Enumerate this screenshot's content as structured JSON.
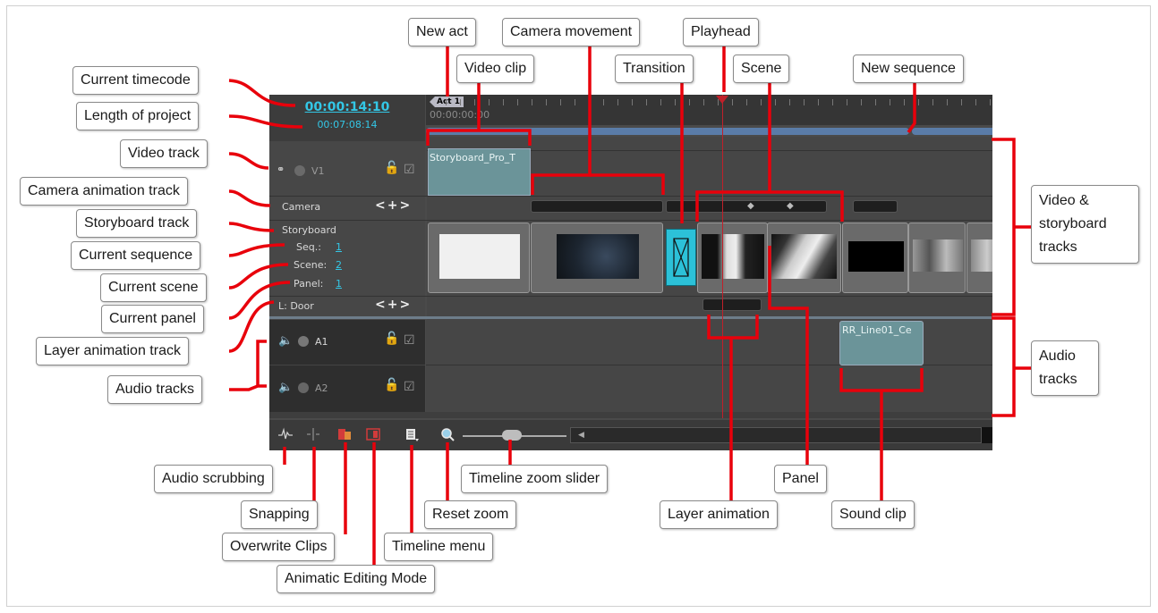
{
  "timeline": {
    "current_timecode": "00:00:14:10",
    "project_length": "00:07:08:14",
    "ruler_timecode": "00:00:00:00",
    "act_marker": "Act 1",
    "tracks": {
      "video": {
        "name": "V1"
      },
      "camera": {
        "name": "Camera"
      },
      "storyboard": {
        "name": "Storyboard"
      },
      "seq_label": "Seq.:",
      "seq_value": "1",
      "scene_label": "Scene:",
      "scene_value": "2",
      "panel_label": "Panel:",
      "panel_value": "1",
      "layer": {
        "name": "L: Door"
      },
      "audio1": {
        "name": "A1"
      },
      "audio2": {
        "name": "A2"
      },
      "nav_buttons": "<+>"
    },
    "video_clip_name": "Storyboard_Pro_T",
    "sound_clip_name": "RR_Line01_Ce"
  },
  "callouts": {
    "new_act": "New act",
    "camera_movement": "Camera movement",
    "playhead": "Playhead",
    "current_timecode": "Current timecode",
    "video_clip": "Video clip",
    "transition": "Transition",
    "scene": "Scene",
    "new_sequence": "New sequence",
    "length_of_project": "Length of project",
    "video_track": "Video track",
    "camera_animation_track": "Camera animation track",
    "storyboard_track": "Storyboard track",
    "current_sequence": "Current sequence",
    "current_scene": "Current scene",
    "current_panel": "Current panel",
    "layer_animation_track": "Layer animation track",
    "audio_tracks_left": "Audio tracks",
    "video_storyboard_tracks": "Video & storyboard tracks",
    "audio_tracks_right": "Audio tracks",
    "audio_scrubbing": "Audio scrubbing",
    "snapping": "Snapping",
    "overwrite_clips": "Overwrite Clips",
    "animatic_editing_mode": "Animatic Editing Mode",
    "timeline_menu": "Timeline menu",
    "reset_zoom": "Reset zoom",
    "timeline_zoom_slider": "Timeline zoom slider",
    "panel": "Panel",
    "layer_animation": "Layer animation",
    "sound_clip": "Sound clip"
  },
  "colors": {
    "accent": "#33c7e6",
    "annotation_line": "#e8000b",
    "playhead": "#c0202a",
    "clip": "#6b9499"
  }
}
